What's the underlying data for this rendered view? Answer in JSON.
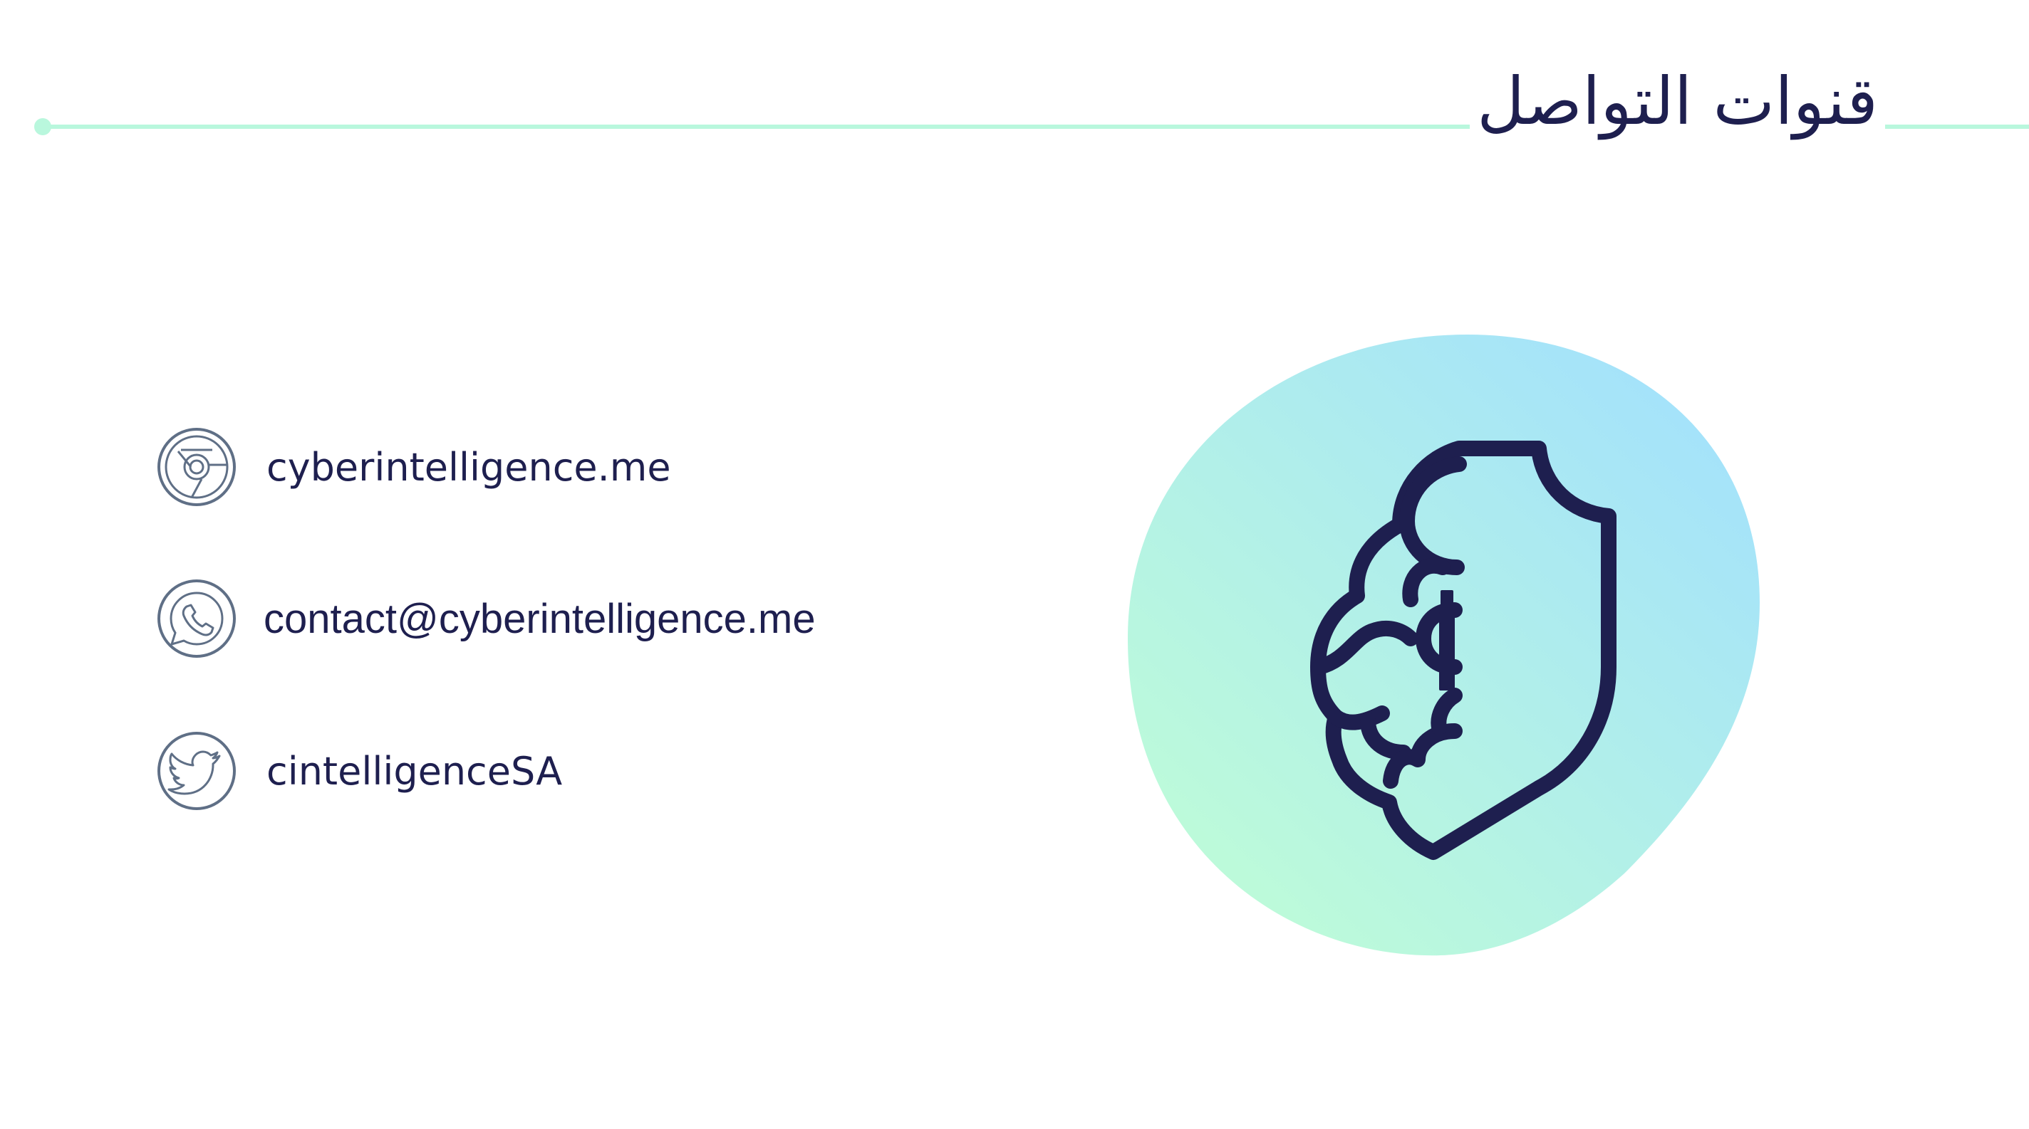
{
  "slide": {
    "title": "قنوات التواصل",
    "accent_color": "#b9f7dd",
    "text_color": "#1e1f4f",
    "icon_color": "#5f6f86"
  },
  "contacts": [
    {
      "icon": "browser-icon",
      "text": "cyberintelligence.me"
    },
    {
      "icon": "whatsapp-icon",
      "text": "contact@cyberintelligence.me"
    },
    {
      "icon": "twitter-icon",
      "text": "cintelligenceSA"
    }
  ],
  "logo": {
    "icon": "brain-shield-logo",
    "gradient": [
      "#bdfbd9",
      "#a4e2fb"
    ]
  }
}
